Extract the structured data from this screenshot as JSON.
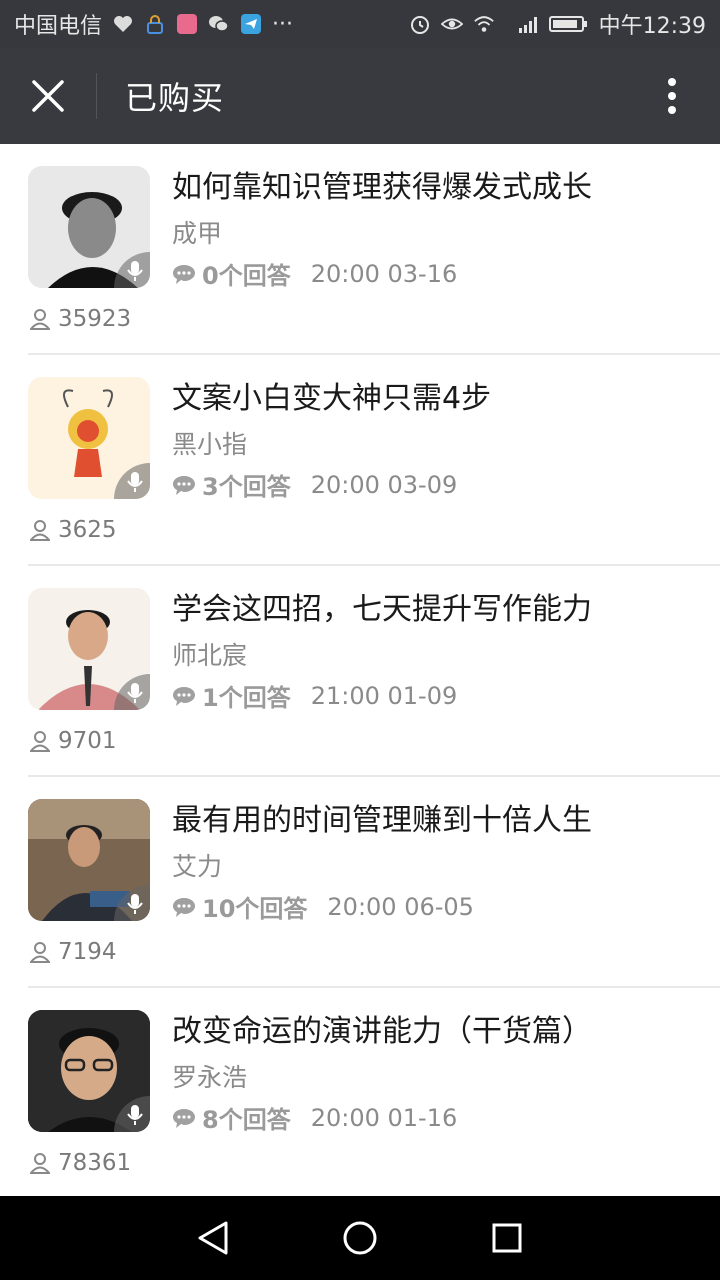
{
  "status_bar": {
    "carrier": "中国电信",
    "time": "中午12:39",
    "dots": "···",
    "network": "4G"
  },
  "header": {
    "title": "已购买"
  },
  "items": [
    {
      "title": "如何靠知识管理获得爆发式成长",
      "author": "成甲",
      "answers": "0个回答",
      "time": "20:00 03-16",
      "listeners": "35923"
    },
    {
      "title": "文案小白变大神只需4步",
      "author": "黑小指",
      "answers": "3个回答",
      "time": "20:00 03-09",
      "listeners": "3625"
    },
    {
      "title": "学会这四招，七天提升写作能力",
      "author": "师北宸",
      "answers": "1个回答",
      "time": "21:00 01-09",
      "listeners": "9701"
    },
    {
      "title": "最有用的时间管理赚到十倍人生",
      "author": "艾力",
      "answers": "10个回答",
      "time": "20:00 06-05",
      "listeners": "7194"
    },
    {
      "title": "改变命运的演讲能力（干货篇）",
      "author": "罗永浩",
      "answers": "8个回答",
      "time": "20:00 01-16",
      "listeners": "78361"
    }
  ]
}
